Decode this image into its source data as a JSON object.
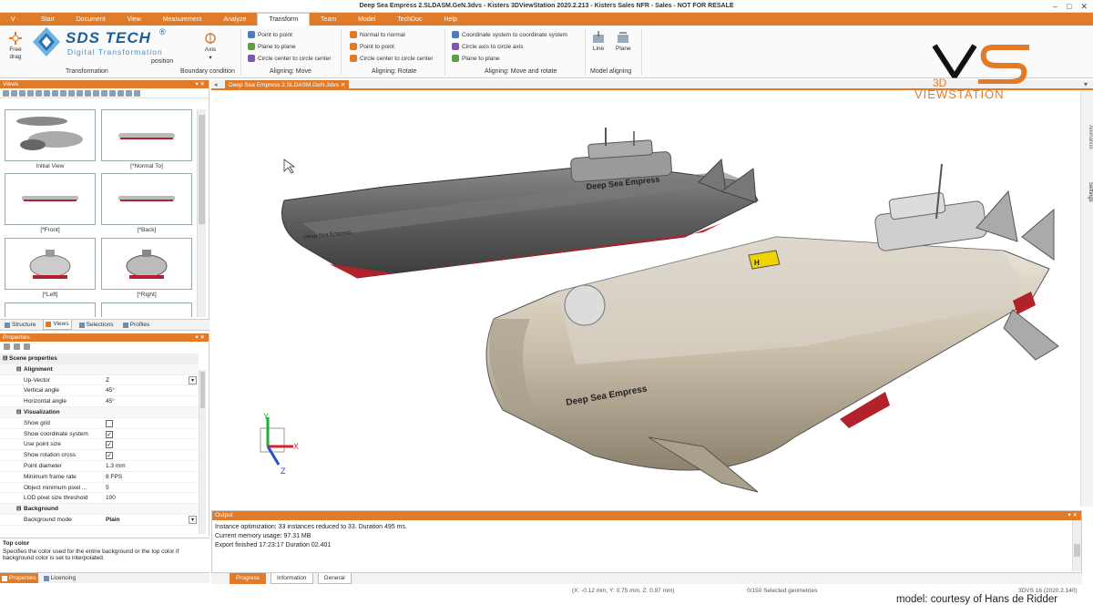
{
  "window": {
    "title": "Deep Sea Empress 2.SLDASM.GeN.3dvs - Kisters 3DViewStation 2020.2.213 - Kisters Sales NFR - Sales - NOT FOR RESALE",
    "controls": [
      "–",
      "□",
      "✕"
    ]
  },
  "ribbon": {
    "app_menu": "V ·",
    "tabs": [
      "Start",
      "Document",
      "View",
      "Measurement",
      "Analyze",
      "Transform",
      "Team",
      "Model",
      "TechDoc",
      "Help"
    ],
    "active_tab": "Transform",
    "left_buttons": [
      {
        "label": "Free",
        "sub": "drag"
      },
      {
        "label": "Axis",
        "sub": "▾"
      }
    ],
    "left_group_labels": {
      "transformation": "Transformation",
      "position": "position",
      "boundary": "Boundary condition"
    },
    "groups": [
      {
        "label": "Aligning: Move",
        "items": [
          "Point to point",
          "Plane to plane",
          "Circle center to circle center"
        ]
      },
      {
        "label": "Aligning: Rotate",
        "items": [
          "Normal to normal",
          "Point to point",
          "Circle center to circle center"
        ]
      },
      {
        "label": "Aligning: Move and rotate",
        "items": [
          "Coordinate system to coordinate system",
          "Circle axis to circle axis",
          "Plane to plane"
        ]
      },
      {
        "label": "Model aligning",
        "items": [
          "Line",
          "Plane"
        ]
      }
    ],
    "icon_colors": {
      "blue": "#4a7fb5",
      "orange": "#e07b2a",
      "green": "#5a9e4a",
      "purple": "#7a5aa8"
    }
  },
  "branding": {
    "sds_name": "SDS TECH",
    "sds_tagline": "Digital Transformation",
    "vs_3d": "3D",
    "vs_name": "VIEWSTATION"
  },
  "views_panel": {
    "title": "Views",
    "thumbnails": [
      "Initial View",
      "[*Normal To]",
      "[*Front]",
      "[*Back]",
      "[*Left]",
      "[*Right]"
    ]
  },
  "left_tabs": [
    "Structure",
    "Views",
    "Selections",
    "Profiles"
  ],
  "left_active_tab": "Views",
  "properties": {
    "title": "Properties",
    "rows": [
      {
        "type": "cat",
        "key": "Scene properties"
      },
      {
        "type": "sub",
        "key": "Alignment"
      },
      {
        "type": "val",
        "key": "Up-Vector",
        "value": "Z"
      },
      {
        "type": "val",
        "key": "Vertical angle",
        "value": "45°"
      },
      {
        "type": "val",
        "key": "Horizontal angle",
        "value": "45°"
      },
      {
        "type": "sub",
        "key": "Visualization"
      },
      {
        "type": "chk",
        "key": "Show grid",
        "value": ""
      },
      {
        "type": "chk",
        "key": "Show coordinate system",
        "value": "✓"
      },
      {
        "type": "chk",
        "key": "Use point size",
        "value": "✓"
      },
      {
        "type": "chk",
        "key": "Show rotation cross",
        "value": "✓"
      },
      {
        "type": "val",
        "key": "Point diameter",
        "value": "1.3 mm"
      },
      {
        "type": "val",
        "key": "Minimum frame rate",
        "value": "8 FPS"
      },
      {
        "type": "val",
        "key": "Object minimum pixel ...",
        "value": "5"
      },
      {
        "type": "val",
        "key": "LOD pixel size threshold",
        "value": "100"
      },
      {
        "type": "sub",
        "key": "Background"
      },
      {
        "type": "val",
        "key": "Background mode",
        "value": "Plain"
      }
    ],
    "description_title": "Top color",
    "description_text": "Specifies the color used for the entire background or the top color if background color is set to interpolated."
  },
  "bottom_left_tabs": [
    "Properties",
    "Licencing"
  ],
  "document": {
    "tab_label": "Deep Sea Empress 2.SLDASM.GeN.3dvs",
    "side_tabs": [
      "Animation",
      "Settings"
    ],
    "axes": [
      "X",
      "Y",
      "Z"
    ],
    "hull_text": "Deep Sea Empress",
    "colors": {
      "accent": "#e07b2a",
      "hull_dark": "#5d5d5d",
      "hull_light": "#c8bda8",
      "keel": "#b3222a"
    }
  },
  "output": {
    "title": "Output",
    "lines": [
      "Instance optimization: 33 instances reduced to 33. Duration 495 ms.",
      "Current memory usage: 97.31 MB",
      "Export finished 17:23:17 Duration 02.401"
    ],
    "tabs": [
      "Progress",
      "Information",
      "General"
    ],
    "active_tab": "Progress"
  },
  "status": {
    "coords": "(X: -0.12 mm, Y: 0.75 mm, Z: 0.97 mm)",
    "selection": "0/150 Selected geometries",
    "version": "3DVS 16 (2020.2.140)"
  },
  "credit": "model: courtesy of Hans de Ridder"
}
